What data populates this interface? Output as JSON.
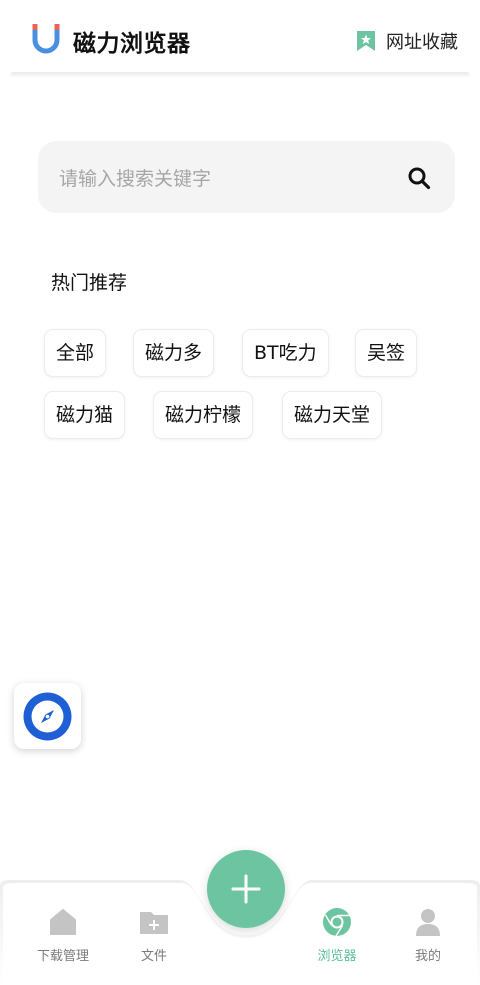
{
  "header": {
    "app_title": "磁力浏览器",
    "bookmark_label": "网址收藏"
  },
  "search": {
    "placeholder": "请输入搜索关键字"
  },
  "hot": {
    "title": "热门推荐",
    "tags": [
      "全部",
      "磁力多",
      "BT吃力",
      "吴签",
      "磁力猫",
      "磁力柠檬",
      "磁力天堂"
    ]
  },
  "nav": {
    "items": [
      {
        "label": "下载管理",
        "icon": "home-icon"
      },
      {
        "label": "文件",
        "icon": "folder-add-icon"
      },
      {
        "label": "浏览器",
        "icon": "chrome-icon"
      },
      {
        "label": "我的",
        "icon": "user-icon"
      }
    ],
    "active_index": 2
  },
  "colors": {
    "accent": "#6cc5a0",
    "active_nav": "#5bbf9a",
    "logo_blue": "#4a90e2",
    "logo_red": "#e8645a"
  }
}
